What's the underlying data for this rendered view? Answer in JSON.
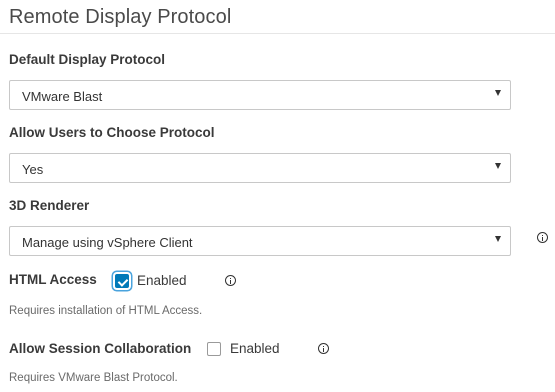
{
  "page": {
    "title": "Remote Display Protocol"
  },
  "default_protocol": {
    "label": "Default Display Protocol",
    "value": "VMware Blast"
  },
  "allow_choose": {
    "label": "Allow Users to Choose Protocol",
    "value": "Yes"
  },
  "renderer_3d": {
    "label": "3D Renderer",
    "value": "Manage using vSphere Client",
    "info_icon": "info-icon"
  },
  "html_access": {
    "label": "HTML Access",
    "checkbox_label": "Enabled",
    "checked": true,
    "info_icon": "info-icon",
    "helper": "Requires installation of HTML Access."
  },
  "session_collab": {
    "label": "Allow Session Collaboration",
    "checkbox_label": "Enabled",
    "checked": false,
    "info_icon": "info-icon",
    "helper": "Requires VMware Blast Protocol."
  },
  "colors": {
    "accent": "#0079b8",
    "text": "#333333",
    "border": "#c8c8c8"
  }
}
